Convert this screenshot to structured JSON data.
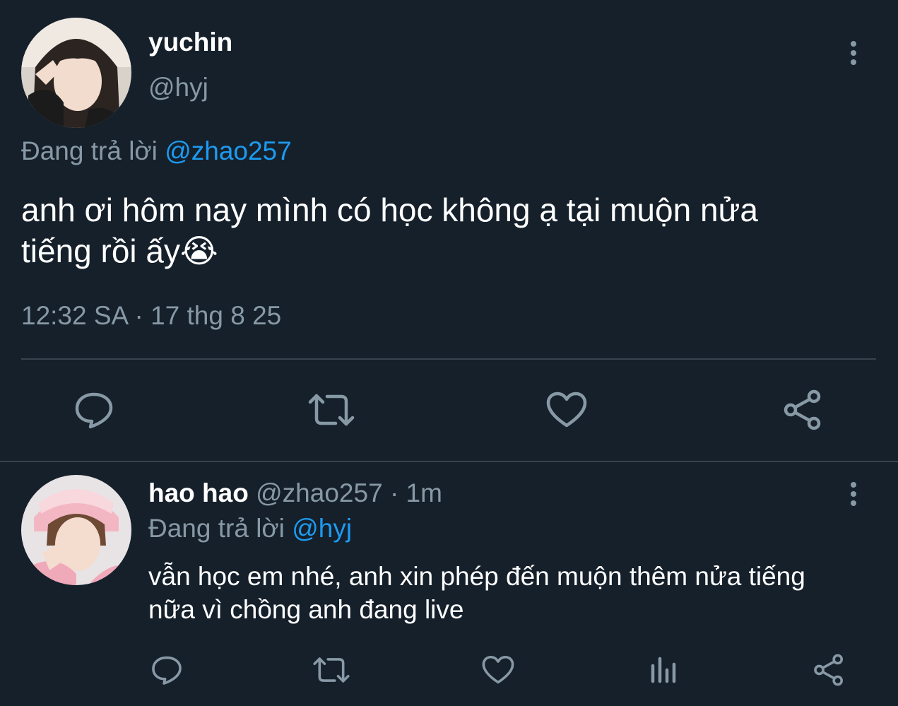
{
  "main_tweet": {
    "display_name": "yuchin",
    "handle": "@hyj",
    "replying_to_prefix": "Đang trả lời",
    "replying_to_handle": "@zhao257",
    "text_line1": "anh ơi hôm nay mình có học không ạ tại muộn nửa",
    "text_line2": "tiếng rồi ấy",
    "emoji": "😭",
    "timestamp": "12:32 SA · 17 thg 8 25",
    "actions": [
      "reply-icon",
      "retweet-icon",
      "like-icon",
      "share-icon"
    ]
  },
  "reply_tweet": {
    "display_name": "hao hao",
    "handle": "@zhao257",
    "time_separator": "·",
    "time": "1m",
    "replying_to_prefix": "Đang trả lời",
    "replying_to_handle": "@hyj",
    "text_line1": "vẫn học em nhé, anh xin phép đến muộn thêm nửa tiếng",
    "text_line2": "nữa vì chồng anh đang live",
    "actions": [
      "reply-icon",
      "retweet-icon",
      "like-icon",
      "analytics-icon",
      "share-icon"
    ]
  },
  "colors": {
    "background": "#15202b",
    "text": "#ffffff",
    "muted": "#8899a6",
    "link": "#1d9bf0",
    "divider": "#38444d"
  }
}
